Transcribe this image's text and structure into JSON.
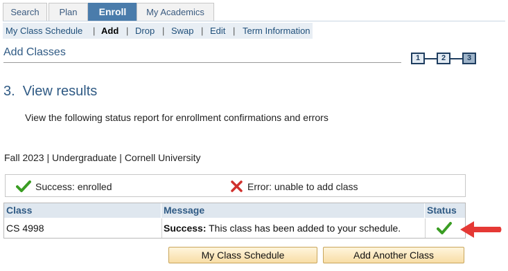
{
  "tabs": [
    {
      "label": "Search"
    },
    {
      "label": "Plan"
    },
    {
      "label": "Enroll"
    },
    {
      "label": "My Academics"
    }
  ],
  "subnav": {
    "my_class_schedule": "My Class Schedule",
    "add": "Add",
    "drop": "Drop",
    "swap": "Swap",
    "edit": "Edit",
    "term_information": "Term Information",
    "separator": "|"
  },
  "page_title": "Add Classes",
  "steps": [
    {
      "label": "1"
    },
    {
      "label": "2"
    },
    {
      "label": "3"
    }
  ],
  "step_heading": "3.  View results",
  "instructions": "View the following status report for enrollment confirmations and errors",
  "term_line": "Fall 2023 | Undergraduate | Cornell University",
  "legend": {
    "success_text": "Success: enrolled",
    "error_text": "Error: unable to add class"
  },
  "results": {
    "headers": {
      "class": "Class",
      "message": "Message",
      "status": "Status"
    },
    "rows": [
      {
        "class": "CS 4998",
        "message_strong": "Success:",
        "message_rest": " This class has been added to your schedule.",
        "status": "success"
      }
    ]
  },
  "buttons": {
    "my_class_schedule": "My Class Schedule",
    "add_another_class": "Add Another Class"
  },
  "colors": {
    "tab_active_bg": "#4a7cab",
    "heading_blue": "#2f5a84",
    "success_green": "#3a9d23",
    "error_red": "#d0312d",
    "arrow_red": "#e53935"
  }
}
